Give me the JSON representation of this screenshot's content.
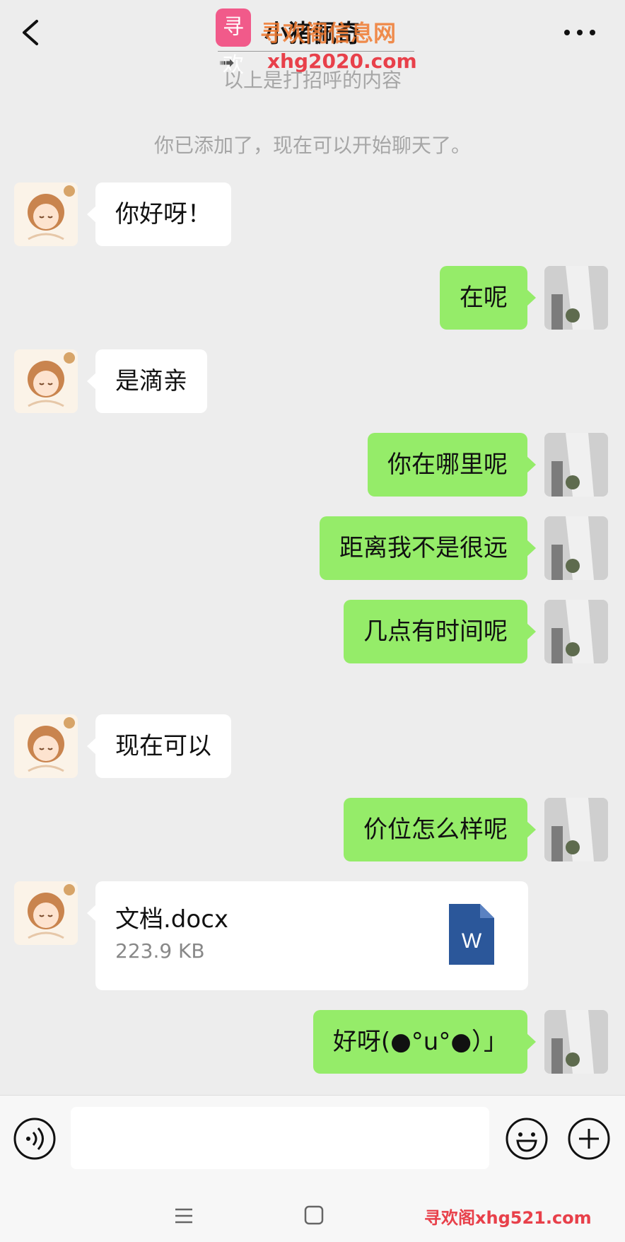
{
  "header": {
    "title": "小猪佩奇",
    "watermark_brand": "寻欢阁信息网",
    "watermark_logo": "寻欢",
    "watermark_url": "xhg2020.com"
  },
  "notes": {
    "greeting": "以上是打招呼的内容",
    "system": "你已添加了，现在可以开始聊天了。"
  },
  "messages": [
    {
      "side": "in",
      "text": "你好呀！"
    },
    {
      "side": "out",
      "text": "在呢"
    },
    {
      "side": "in",
      "text": "是滴亲"
    },
    {
      "side": "out",
      "text": "你在哪里呢"
    },
    {
      "side": "out",
      "text": "距离我不是很远"
    },
    {
      "side": "out",
      "text": "几点有时间呢"
    },
    {
      "side": "in",
      "text": "现在可以"
    },
    {
      "side": "out",
      "text": "价位怎么样呢"
    },
    {
      "side": "out",
      "text": "好呀(●°u°●）」"
    }
  ],
  "file": {
    "name": "文档.docx",
    "size": "223.9 KB",
    "icon": "word-doc-icon"
  },
  "input": {
    "placeholder": ""
  },
  "footer": {
    "watermark": "寻欢阁xhg521.com"
  },
  "colors": {
    "outgoing_bubble": "#95ec69",
    "incoming_bubble": "#ffffff",
    "background": "#ededed",
    "word_icon": "#2b579a"
  }
}
